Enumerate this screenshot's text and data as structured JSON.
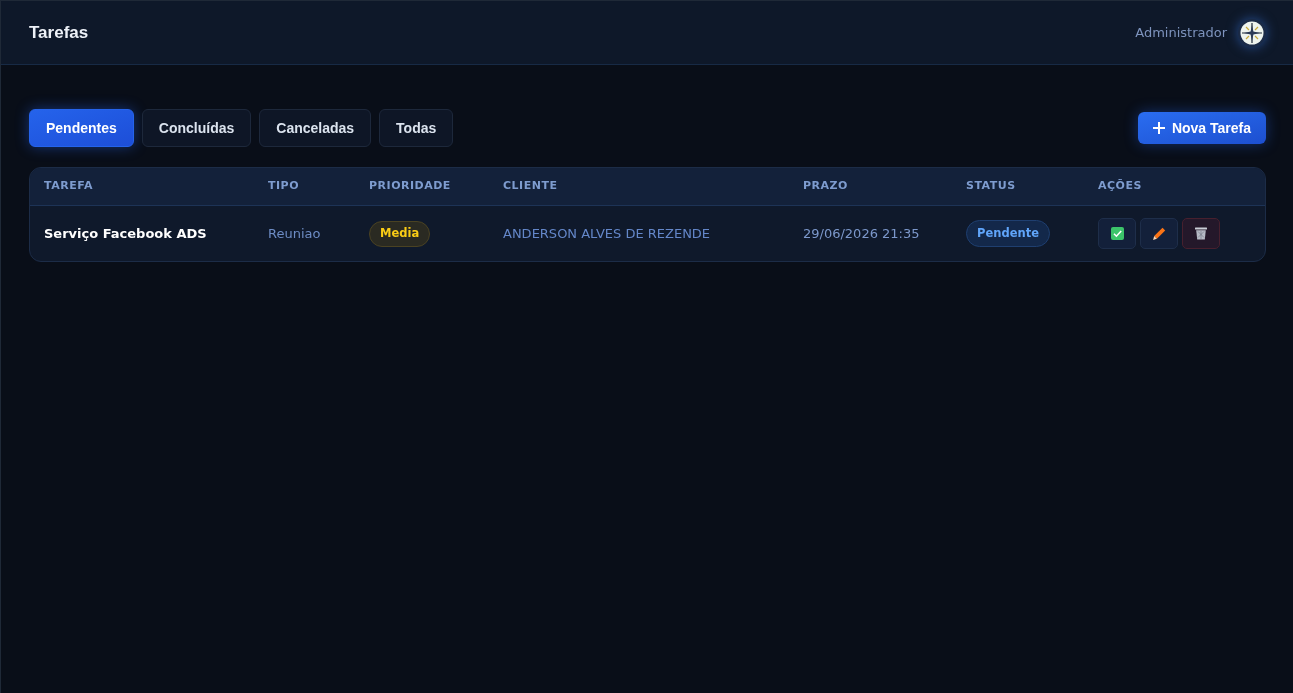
{
  "header": {
    "title": "Tarefas",
    "user": {
      "name": "Administrador"
    }
  },
  "tabs": [
    {
      "label": "Pendentes",
      "selected": true
    },
    {
      "label": "Concluídas",
      "selected": false
    },
    {
      "label": "Canceladas",
      "selected": false
    },
    {
      "label": "Todas",
      "selected": false
    }
  ],
  "new_task_button": {
    "label": "Nova Tarefa"
  },
  "table": {
    "columns": [
      "TAREFA",
      "TIPO",
      "PRIORIDADE",
      "CLIENTE",
      "PRAZO",
      "STATUS",
      "AÇÕES"
    ],
    "rows": [
      {
        "task": "Serviço Facebook ADS",
        "type": "Reuniao",
        "priority": {
          "label": "Media",
          "kind": "medium"
        },
        "client": "ANDERSON ALVES DE REZENDE",
        "deadline": "29/06/2026 21:35",
        "status": {
          "label": "Pendente",
          "kind": "pending"
        },
        "actions": [
          {
            "kind": "complete"
          },
          {
            "kind": "edit"
          },
          {
            "kind": "delete"
          }
        ]
      }
    ]
  }
}
